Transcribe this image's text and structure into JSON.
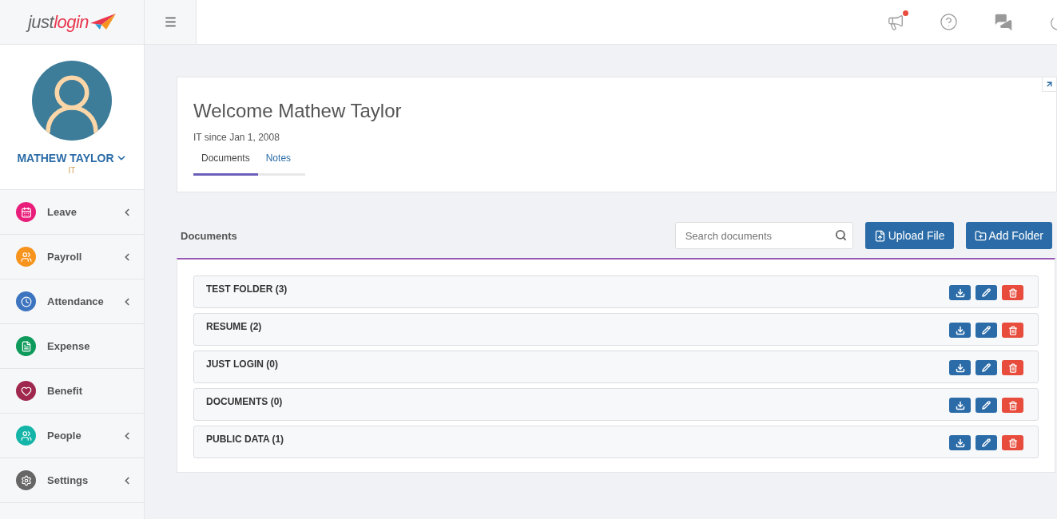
{
  "logo": {
    "part_1": "just",
    "part_2": "login"
  },
  "topbar": {
    "notification_dot": true
  },
  "profile": {
    "name": "MATHEW TAYLOR",
    "department": "IT"
  },
  "sidebar": {
    "items": [
      {
        "label": "Leave",
        "kind": "calendar",
        "color": "#e91e7a",
        "has_submenu": true
      },
      {
        "label": "Payroll",
        "kind": "payroll",
        "color": "#f7941d",
        "has_submenu": true
      },
      {
        "label": "Attendance",
        "kind": "clock",
        "color": "#3c74bf",
        "has_submenu": true
      },
      {
        "label": "Expense",
        "kind": "receipt",
        "color": "#0e9a5a",
        "has_submenu": false
      },
      {
        "label": "Benefit",
        "kind": "heart",
        "color": "#a0284f",
        "has_submenu": false
      },
      {
        "label": "People",
        "kind": "people",
        "color": "#14b5a8",
        "has_submenu": true
      },
      {
        "label": "Settings",
        "kind": "gear",
        "color": "#666666",
        "has_submenu": true
      }
    ]
  },
  "welcome": {
    "title": "Welcome Mathew Taylor",
    "subtitle": "IT since Jan 1, 2008",
    "tabs": [
      {
        "label": "Documents",
        "selected": true
      },
      {
        "label": "Notes",
        "selected": false
      }
    ]
  },
  "documents": {
    "title": "Documents",
    "search": {
      "placeholder": "Search documents"
    },
    "buttons": [
      {
        "label": "Upload File",
        "kind": "upload"
      },
      {
        "label": "Add Folder",
        "kind": "folder"
      }
    ],
    "folders": [
      {
        "name": "TEST FOLDER (3)"
      },
      {
        "name": "RESUME (2)"
      },
      {
        "name": "JUST LOGIN (0)"
      },
      {
        "name": "DOCUMENTS (0)"
      },
      {
        "name": "PUBLIC DATA (1)"
      }
    ]
  }
}
